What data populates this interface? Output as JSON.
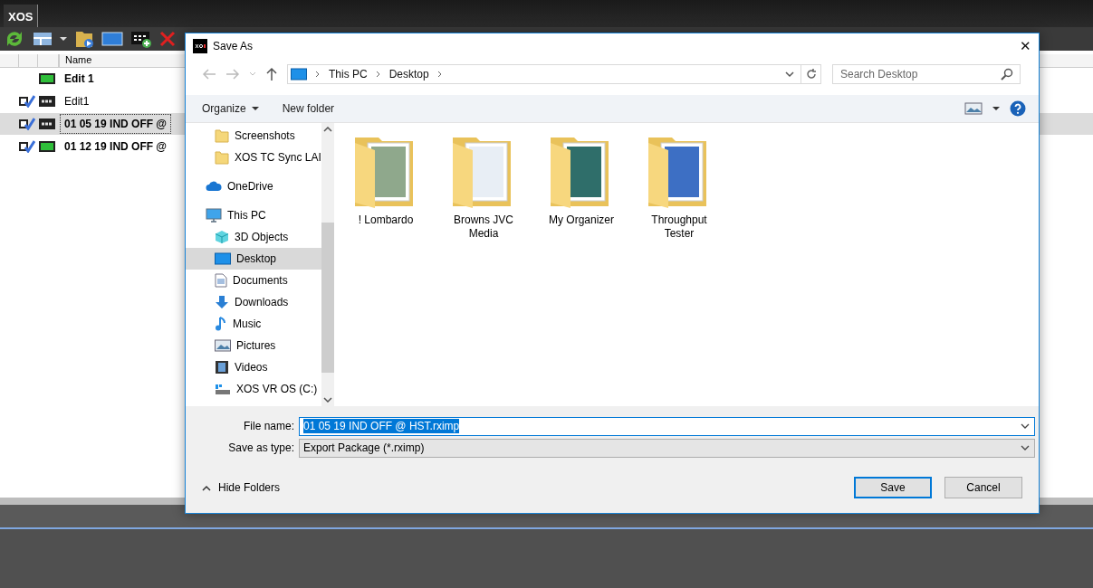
{
  "app": {
    "tab": "XOS",
    "columns": [
      {
        "label": "Name"
      }
    ],
    "rows": [
      {
        "name": "Edit 1",
        "bold": true,
        "status": false,
        "active": true,
        "selected": false
      },
      {
        "name": "Edit1",
        "bold": false,
        "status": true,
        "active": false,
        "selected": false
      },
      {
        "name": "01 05 19 IND OFF @",
        "bold": true,
        "status": true,
        "active": false,
        "selected": true
      },
      {
        "name": "01 12 19 IND OFF @",
        "bold": true,
        "status": true,
        "active": true,
        "selected": false
      }
    ]
  },
  "dialog": {
    "title": "Save As",
    "close": "✕",
    "breadcrumb": [
      "This PC",
      "Desktop"
    ],
    "search": {
      "placeholder": "Search Desktop"
    },
    "commands": [
      "Organize",
      "New folder"
    ],
    "quick_access": [
      {
        "label": "Screenshots",
        "kind": "folder",
        "selected": false
      },
      {
        "label": "XOS TC Sync LAI",
        "kind": "folder",
        "selected": false
      }
    ],
    "nav": [
      {
        "label": "OneDrive",
        "kind": "cloud",
        "selected": false
      },
      {
        "label": "This PC",
        "kind": "pc",
        "selected": false,
        "children": [
          {
            "label": "3D Objects",
            "kind": "cube",
            "selected": false
          },
          {
            "label": "Desktop",
            "kind": "desktop",
            "selected": true
          },
          {
            "label": "Documents",
            "kind": "doc",
            "selected": false
          },
          {
            "label": "Downloads",
            "kind": "download",
            "selected": false
          },
          {
            "label": "Music",
            "kind": "music",
            "selected": false
          },
          {
            "label": "Pictures",
            "kind": "pictures",
            "selected": false
          },
          {
            "label": "Videos",
            "kind": "video",
            "selected": false
          },
          {
            "label": "XOS VR OS (C:)",
            "kind": "drive",
            "selected": false
          }
        ]
      }
    ],
    "files": [
      {
        "name": "! Lombardo",
        "color": "#8fa88c"
      },
      {
        "name": "Browns JVC Media",
        "color": "#e8eef5"
      },
      {
        "name": "My Organizer",
        "color": "#2f6e6a"
      },
      {
        "name": "Throughput Tester",
        "color": "#3d6fc4"
      }
    ],
    "file_name": {
      "label": "File name:",
      "value": "01 05 19 IND OFF @ HST.rximp"
    },
    "save_type": {
      "label": "Save as type:",
      "value": "Export Package (*.rximp)"
    },
    "hide_folders": "Hide Folders",
    "buttons": [
      {
        "label": "Save",
        "default": true
      },
      {
        "label": "Cancel",
        "default": false
      }
    ]
  }
}
